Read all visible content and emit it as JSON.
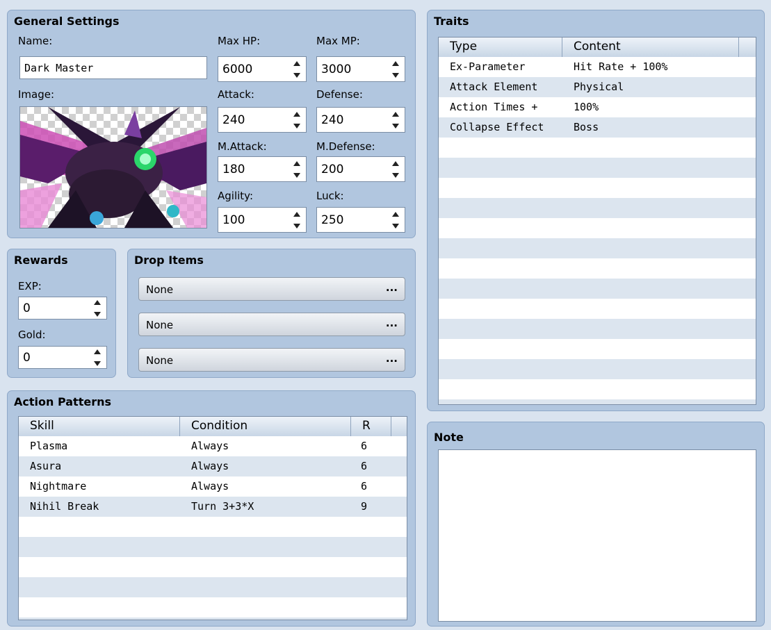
{
  "general": {
    "title": "General Settings",
    "name_label": "Name:",
    "name_value": "Dark Master",
    "image_label": "Image:",
    "stats": {
      "max_hp": {
        "label": "Max HP:",
        "value": "6000"
      },
      "max_mp": {
        "label": "Max MP:",
        "value": "3000"
      },
      "attack": {
        "label": "Attack:",
        "value": "240"
      },
      "defense": {
        "label": "Defense:",
        "value": "240"
      },
      "m_attack": {
        "label": "M.Attack:",
        "value": "180"
      },
      "m_defense": {
        "label": "M.Defense:",
        "value": "200"
      },
      "agility": {
        "label": "Agility:",
        "value": "100"
      },
      "luck": {
        "label": "Luck:",
        "value": "250"
      }
    }
  },
  "rewards": {
    "title": "Rewards",
    "exp_label": "EXP:",
    "exp_value": "0",
    "gold_label": "Gold:",
    "gold_value": "0"
  },
  "drops": {
    "title": "Drop Items",
    "items": [
      "None",
      "None",
      "None"
    ],
    "ellipsis": "..."
  },
  "actions": {
    "title": "Action Patterns",
    "headers": [
      "Skill",
      "Condition",
      "R"
    ],
    "rows": [
      [
        "Plasma",
        "Always",
        "6"
      ],
      [
        "Asura",
        "Always",
        "6"
      ],
      [
        "Nightmare",
        "Always",
        "6"
      ],
      [
        "Nihil Break",
        "Turn 3+3*X",
        "9"
      ]
    ]
  },
  "traits": {
    "title": "Traits",
    "headers": [
      "Type",
      "Content"
    ],
    "rows": [
      [
        "Ex-Parameter",
        "Hit Rate + 100%"
      ],
      [
        "Attack Element",
        "Physical"
      ],
      [
        "Action Times +",
        "100%"
      ],
      [
        "Collapse Effect",
        "Boss"
      ]
    ]
  },
  "note": {
    "title": "Note",
    "value": ""
  },
  "colors": {
    "panel_bg": "#b1c6df",
    "row_alt": "#dce5ef",
    "page_bg": "#d9e3ef"
  }
}
